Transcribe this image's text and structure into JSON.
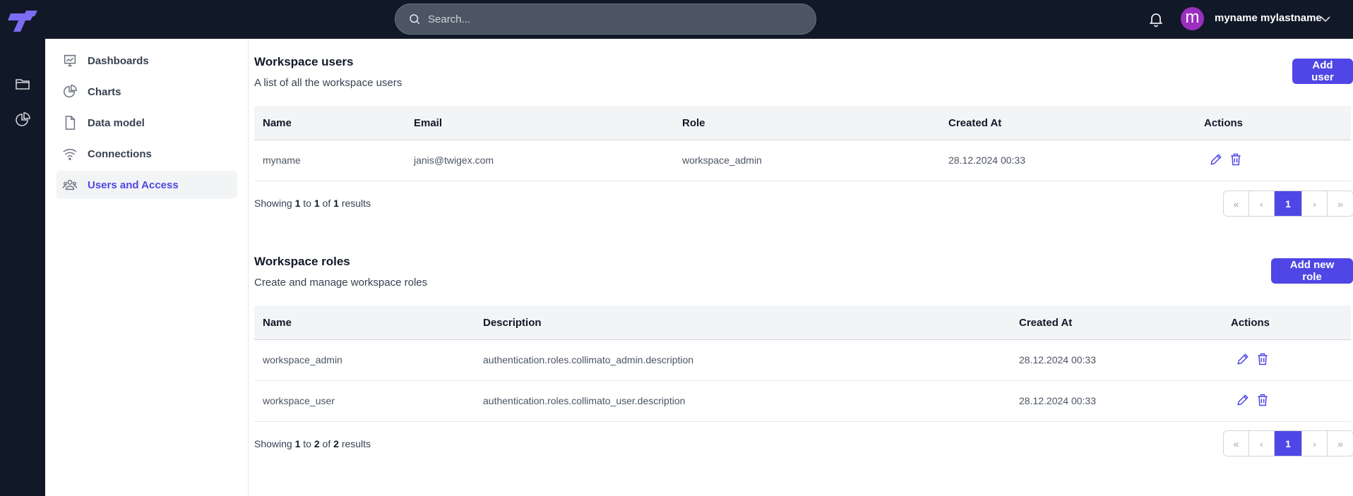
{
  "header": {
    "search_placeholder": "Search...",
    "user_initial": "m",
    "user_name": "myname mylastname"
  },
  "sidebar": {
    "items": [
      {
        "label": "Dashboards"
      },
      {
        "label": "Charts"
      },
      {
        "label": "Data model"
      },
      {
        "label": "Connections"
      },
      {
        "label": "Users and Access"
      }
    ]
  },
  "users": {
    "title": "Workspace users",
    "subtitle": "A list of all the workspace users",
    "add_label": "Add user",
    "columns": [
      "Name",
      "Email",
      "Role",
      "Created At",
      "Actions"
    ],
    "rows": [
      {
        "name": "myname",
        "email": "janis@twigex.com",
        "role": "workspace_admin",
        "created": "28.12.2024 00:33"
      }
    ],
    "showing": {
      "prefix": "Showing",
      "from": "1",
      "to_word": "to",
      "to": "1",
      "of_word": "of",
      "total": "1",
      "suffix": "results"
    },
    "page": "1"
  },
  "roles": {
    "title": "Workspace roles",
    "subtitle": "Create and manage workspace roles",
    "add_label": "Add new role",
    "columns": [
      "Name",
      "Description",
      "Created At",
      "Actions"
    ],
    "rows": [
      {
        "name": "workspace_admin",
        "description": "authentication.roles.collimato_admin.description",
        "created": "28.12.2024 00:33"
      },
      {
        "name": "workspace_user",
        "description": "authentication.roles.collimato_user.description",
        "created": "28.12.2024 00:33"
      }
    ],
    "showing": {
      "prefix": "Showing",
      "from": "1",
      "to_word": "to",
      "to": "2",
      "of_word": "of",
      "total": "2",
      "suffix": "results"
    },
    "page": "1"
  },
  "colors": {
    "accent": "#4f46e5",
    "topbar": "#111827",
    "avatar": "#9b2fbf"
  }
}
